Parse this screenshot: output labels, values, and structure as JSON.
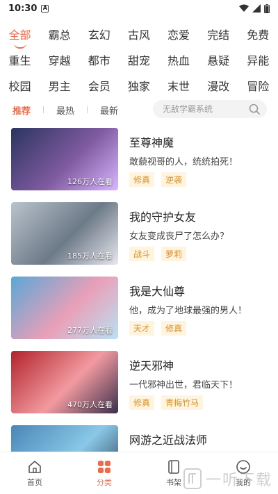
{
  "status": {
    "time": "10:30",
    "sim": "A"
  },
  "categories": [
    [
      "全部",
      "霸总",
      "玄幻",
      "古风",
      "恋爱",
      "完结",
      "免费"
    ],
    [
      "重生",
      "穿越",
      "都市",
      "甜宠",
      "热血",
      "悬疑",
      "异能"
    ],
    [
      "校园",
      "男主",
      "会员",
      "独家",
      "末世",
      "漫改",
      "冒险"
    ]
  ],
  "active_category": "全部",
  "sort_tabs": [
    "推荐",
    "最热",
    "最新"
  ],
  "active_sort": "推荐",
  "search": {
    "placeholder": "无敌学霸系统"
  },
  "comics": [
    {
      "title": "至尊神魔",
      "desc": "敢藐视哥的人，统统拍死！",
      "viewers": "126万人在看",
      "tags": [
        "修真",
        "逆袭"
      ],
      "colors": [
        "#2a3560",
        "#7f5aa0",
        "#d9b6ff"
      ]
    },
    {
      "title": "我的守护女友",
      "desc": "女友变成丧尸了怎么办？",
      "viewers": "185万人在看",
      "tags": [
        "战斗",
        "萝莉"
      ],
      "colors": [
        "#b9c3cc",
        "#6d7a88",
        "#e8e8ef"
      ]
    },
    {
      "title": "我是大仙尊",
      "desc": "他，成为了地球最强的男人！",
      "viewers": "277万人在看",
      "tags": [
        "天才",
        "修真"
      ],
      "colors": [
        "#5aa7d8",
        "#e9a0b8",
        "#b8e2f4"
      ]
    },
    {
      "title": "逆天邪神",
      "desc": "一代邪神出世，君临天下！",
      "viewers": "470万人在看",
      "tags": [
        "修真",
        "青梅竹马"
      ],
      "colors": [
        "#b3222b",
        "#f29aa0",
        "#3a2f4a"
      ]
    },
    {
      "title": "网游之近战法师",
      "desc": "",
      "viewers": "",
      "tags": [],
      "colors": [
        "#4a86b8",
        "#89c8e6",
        "#2b3e58"
      ]
    }
  ],
  "nav": [
    {
      "label": "首页",
      "icon": "home-icon"
    },
    {
      "label": "分类",
      "icon": "category-icon"
    },
    {
      "label": "书架",
      "icon": "bookshelf-icon"
    },
    {
      "label": "我的",
      "icon": "profile-icon"
    }
  ],
  "active_nav": "分类",
  "accent": "#ef6a4a",
  "tag_color": "#d8932b",
  "watermark": "一听下载"
}
